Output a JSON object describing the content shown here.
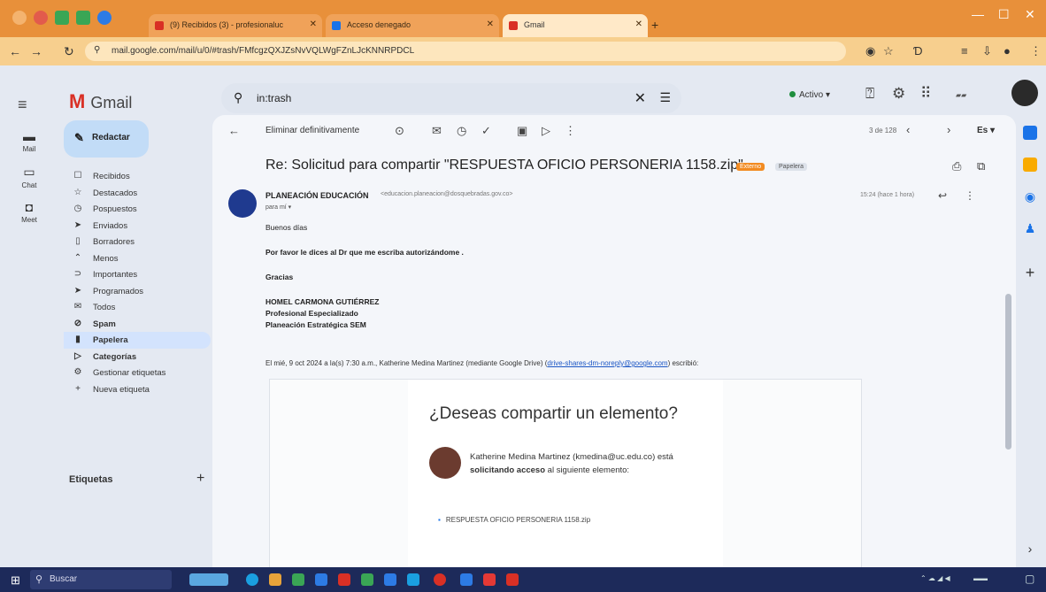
{
  "browser": {
    "tabs": [
      {
        "title": "(9) Recibidos (3) - profesionaluc",
        "color": "#d93025",
        "active": false
      },
      {
        "title": "Acceso denegado",
        "color": "#1a73e8",
        "active": false
      },
      {
        "title": "Gmail",
        "color": "#d93025",
        "active": true
      }
    ],
    "url": "mail.google.com/mail/u/0/#trash/FMfcgzQXJZsNvVQLWgFZnLJcKNNRPDCL",
    "new_tab": "+"
  },
  "gmail": {
    "logo": "Gmail",
    "search_value": "in:trash",
    "status": "Activo",
    "rail": [
      {
        "label": "Mail",
        "icon": "mail-icon"
      },
      {
        "label": "Chat",
        "icon": "chat-icon"
      },
      {
        "label": "Meet",
        "icon": "meet-icon"
      }
    ],
    "compose": "Redactar",
    "nav": [
      {
        "label": "Recibidos",
        "icon": "☐",
        "cls": ""
      },
      {
        "label": "Destacados",
        "icon": "☆",
        "cls": ""
      },
      {
        "label": "Pospuestos",
        "icon": "◷",
        "cls": ""
      },
      {
        "label": "Enviados",
        "icon": "➤",
        "cls": ""
      },
      {
        "label": "Borradores",
        "icon": "▯",
        "cls": ""
      },
      {
        "label": "Menos",
        "icon": "⌃",
        "cls": ""
      },
      {
        "label": "Importantes",
        "icon": "⊃",
        "cls": ""
      },
      {
        "label": "Programados",
        "icon": "➤",
        "cls": ""
      },
      {
        "label": "Todos",
        "icon": "✉",
        "cls": ""
      },
      {
        "label": "Spam",
        "icon": "⊘",
        "cls": "bold"
      },
      {
        "label": "Papelera",
        "icon": "▮",
        "cls": "active"
      },
      {
        "label": "Categorías",
        "icon": "▷",
        "cls": "bold"
      },
      {
        "label": "Gestionar etiquetas",
        "icon": "⚙",
        "cls": ""
      },
      {
        "label": "Nueva etiqueta",
        "icon": "+",
        "cls": ""
      }
    ],
    "labels_heading": "Etiquetas",
    "toolbar": {
      "delete_forever": "Eliminar definitivamente",
      "pager": "3 de 128",
      "lang": "Es"
    },
    "message": {
      "subject": "Re: Solicitud para compartir \"RESPUESTA OFICIO PERSONERIA 1158.zip\"",
      "badge_external": "Externo",
      "badge_trash": "Papelera",
      "sender_name": "PLANEACIÓN EDUCACIÓN",
      "sender_email": "<educacion.planeacion@dosquebradas.gov.co>",
      "to": "para mí",
      "time": "15:24 (hace 1 hora)",
      "greeting": "Buenos días",
      "line1": "Por favor le dices al Dr que me escriba autorizándome .",
      "thanks": "Gracias",
      "sig_name": "HOMEL CARMONA GUTIÉRREZ",
      "sig_title": "Profesional Especializado",
      "sig_dept": "Planeación Estratégica SEM",
      "quote_prefix": "El mié, 9 oct 2024 a la(s) 7:30 a.m., Katherine Medina Martinez (mediante Google Drive) (",
      "quote_email": "drive-shares-dm-noreply@google.com",
      "quote_suffix": ") escribió:",
      "card_title": "¿Deseas compartir un elemento?",
      "req_before": "Katherine Medina Martinez (kmedina@uc.edu.co) está ",
      "req_bold": "solicitando acceso",
      "req_after": " al siguiente elemento:",
      "file": "RESPUESTA OFICIO PERSONERIA 1158.zip"
    }
  },
  "taskbar": {
    "search": "Buscar"
  }
}
